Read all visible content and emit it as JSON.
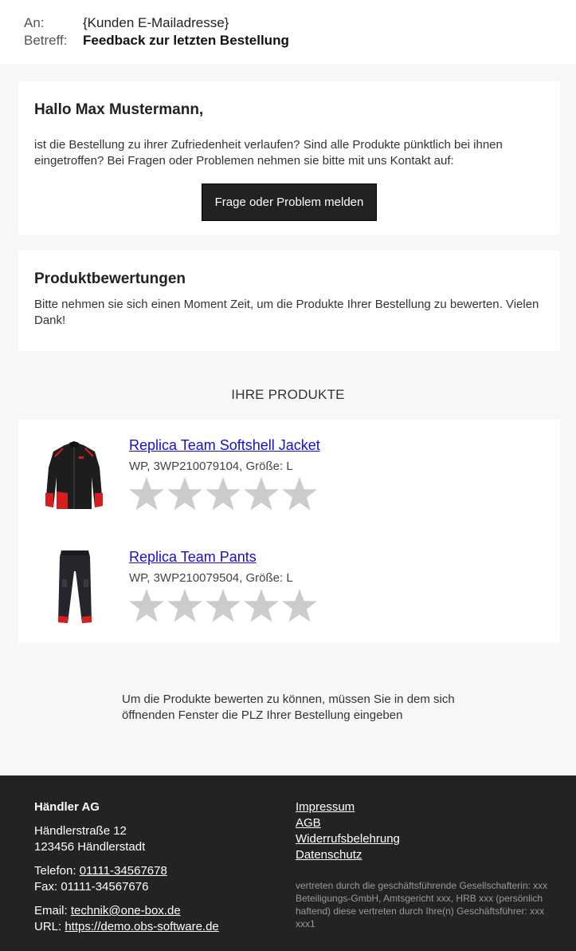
{
  "email": {
    "to_label": "An:",
    "to_value": "{Kunden E-Mailadresse}",
    "subject_label": "Betreff:",
    "subject_value": "Feedback zur letzten Bestellung"
  },
  "greeting": {
    "title": "Hallo Max Mustermann,",
    "text": "ist die Bestellung zu ihrer Zufriedenheit verlaufen? Sind alle Produkte pünktlich bei ihnen eingetroffen? Bei Fragen oder Problemen nehmen sie bitte mit uns Kontakt auf:",
    "button_label": "Frage oder Problem melden"
  },
  "reviews": {
    "title": "Produktbewertungen",
    "text": "Bitte nehmen sie sich einen Moment Zeit, um die Produkte Ihrer Bestellung zu bewerten. Vielen Dank!"
  },
  "products": {
    "heading": "IHRE PRODUKTE",
    "items": [
      {
        "name": "Replica Team Softshell Jacket",
        "meta": "WP, 3WP210079104, Größe: L",
        "image": "jacket",
        "rating": 0,
        "max_rating": 5
      },
      {
        "name": "Replica Team Pants",
        "meta": "WP, 3WP210079504, Größe: L",
        "image": "pants",
        "rating": 0,
        "max_rating": 5
      }
    ],
    "star_color": "#cccccc"
  },
  "note": "Um die Produkte bewerten zu können, müssen Sie in dem sich öffnenden Fenster die PLZ Ihrer Bestellung eingeben",
  "footer": {
    "company": "Händler AG",
    "street": "Händlerstraße 12",
    "city": "123456 Händlerstadt",
    "phone_label": "Telefon: ",
    "phone": "01111-34567678",
    "fax": "Fax: 01111-34567676",
    "email_label": "Email: ",
    "email": "technik@one-box.de",
    "url_label": "URL: ",
    "url": "https://demo.obs-software.de",
    "links": [
      "Impressum",
      "AGB",
      "Widerrufsbelehrung",
      "Datenschutz"
    ],
    "legal": "vertreten durch die geschäftsführende Gesellschafterin: xxx Beteiligungs-GmbH, Amtsgericht xxx, HRB xxx (persönlich haftend) diese vertreten durch Ihre(n) Geschäftsführer: xxx xxx1"
  },
  "colors": {
    "page_bg": "#f6f7f9",
    "footer_bg": "#232323",
    "button_bg": "#222222",
    "link_color": "#1a0dcc"
  }
}
